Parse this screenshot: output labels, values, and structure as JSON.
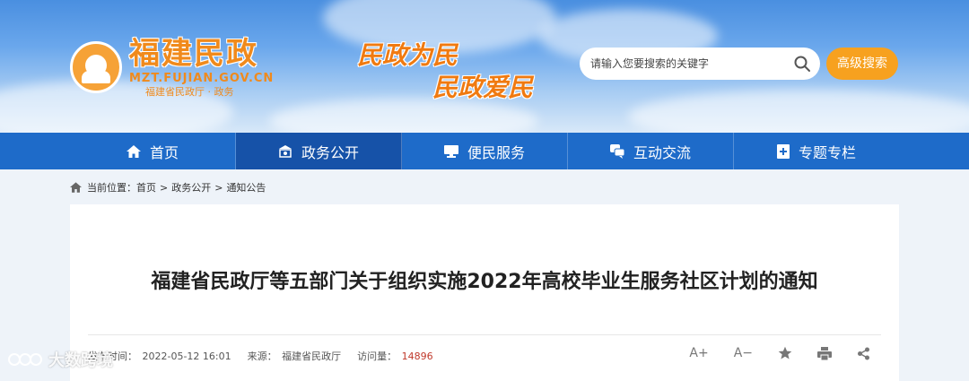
{
  "header": {
    "logo_title": "福建民政",
    "logo_domain": "MZT.FUJIAN.GOV.CN",
    "logo_sub": "福建省民政厅 · 政务",
    "slogan_1": "民政为民",
    "slogan_2": "民政爱民",
    "search_placeholder": "请输入您要搜索的关键字",
    "advanced_search_label": "高级搜索"
  },
  "nav": {
    "items": [
      {
        "label": "首页",
        "icon": "home-icon"
      },
      {
        "label": "政务公开",
        "icon": "building-icon",
        "active": true
      },
      {
        "label": "便民服务",
        "icon": "monitor-icon"
      },
      {
        "label": "互动交流",
        "icon": "chat-icon"
      },
      {
        "label": "专题专栏",
        "icon": "bookmark-plus-icon"
      }
    ]
  },
  "breadcrumb": {
    "prefix": "当前位置：",
    "items": [
      "首页",
      "政务公开",
      "通知公告"
    ],
    "separator": ">"
  },
  "article": {
    "title": "福建省民政厅等五部门关于组织实施2022年高校毕业生服务社区计划的通知",
    "publish_label": "发布时间：",
    "publish_time": "2022-05-12 16:01",
    "source_label": "来源：",
    "source": "福建省民政厅",
    "views_label": "访问量：",
    "views": "14896"
  },
  "tools": {
    "font_increase": "A+",
    "font_decrease": "A−"
  },
  "watermark": "大数跨境",
  "colors": {
    "nav_bg": "#1e6bc9",
    "nav_active": "#1652a8",
    "accent_orange": "#f7a11f",
    "count_red": "#c0392b"
  }
}
